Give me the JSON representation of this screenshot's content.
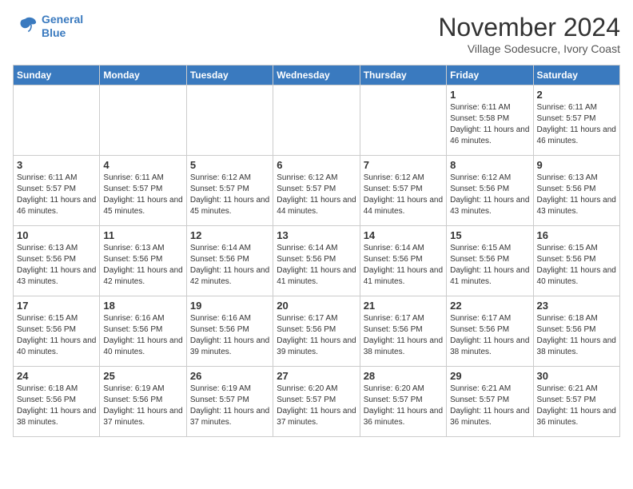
{
  "header": {
    "logo_line1": "General",
    "logo_line2": "Blue",
    "main_title": "November 2024",
    "subtitle": "Village Sodesucre, Ivory Coast"
  },
  "days_of_week": [
    "Sunday",
    "Monday",
    "Tuesday",
    "Wednesday",
    "Thursday",
    "Friday",
    "Saturday"
  ],
  "weeks": [
    [
      {
        "day": null
      },
      {
        "day": null
      },
      {
        "day": null
      },
      {
        "day": null
      },
      {
        "day": null
      },
      {
        "day": "1",
        "sunrise": "6:11 AM",
        "sunset": "5:58 PM",
        "daylight": "11 hours and 46 minutes."
      },
      {
        "day": "2",
        "sunrise": "6:11 AM",
        "sunset": "5:57 PM",
        "daylight": "11 hours and 46 minutes."
      }
    ],
    [
      {
        "day": "3",
        "sunrise": "6:11 AM",
        "sunset": "5:57 PM",
        "daylight": "11 hours and 46 minutes."
      },
      {
        "day": "4",
        "sunrise": "6:11 AM",
        "sunset": "5:57 PM",
        "daylight": "11 hours and 45 minutes."
      },
      {
        "day": "5",
        "sunrise": "6:12 AM",
        "sunset": "5:57 PM",
        "daylight": "11 hours and 45 minutes."
      },
      {
        "day": "6",
        "sunrise": "6:12 AM",
        "sunset": "5:57 PM",
        "daylight": "11 hours and 44 minutes."
      },
      {
        "day": "7",
        "sunrise": "6:12 AM",
        "sunset": "5:57 PM",
        "daylight": "11 hours and 44 minutes."
      },
      {
        "day": "8",
        "sunrise": "6:12 AM",
        "sunset": "5:56 PM",
        "daylight": "11 hours and 43 minutes."
      },
      {
        "day": "9",
        "sunrise": "6:13 AM",
        "sunset": "5:56 PM",
        "daylight": "11 hours and 43 minutes."
      }
    ],
    [
      {
        "day": "10",
        "sunrise": "6:13 AM",
        "sunset": "5:56 PM",
        "daylight": "11 hours and 43 minutes."
      },
      {
        "day": "11",
        "sunrise": "6:13 AM",
        "sunset": "5:56 PM",
        "daylight": "11 hours and 42 minutes."
      },
      {
        "day": "12",
        "sunrise": "6:14 AM",
        "sunset": "5:56 PM",
        "daylight": "11 hours and 42 minutes."
      },
      {
        "day": "13",
        "sunrise": "6:14 AM",
        "sunset": "5:56 PM",
        "daylight": "11 hours and 41 minutes."
      },
      {
        "day": "14",
        "sunrise": "6:14 AM",
        "sunset": "5:56 PM",
        "daylight": "11 hours and 41 minutes."
      },
      {
        "day": "15",
        "sunrise": "6:15 AM",
        "sunset": "5:56 PM",
        "daylight": "11 hours and 41 minutes."
      },
      {
        "day": "16",
        "sunrise": "6:15 AM",
        "sunset": "5:56 PM",
        "daylight": "11 hours and 40 minutes."
      }
    ],
    [
      {
        "day": "17",
        "sunrise": "6:15 AM",
        "sunset": "5:56 PM",
        "daylight": "11 hours and 40 minutes."
      },
      {
        "day": "18",
        "sunrise": "6:16 AM",
        "sunset": "5:56 PM",
        "daylight": "11 hours and 40 minutes."
      },
      {
        "day": "19",
        "sunrise": "6:16 AM",
        "sunset": "5:56 PM",
        "daylight": "11 hours and 39 minutes."
      },
      {
        "day": "20",
        "sunrise": "6:17 AM",
        "sunset": "5:56 PM",
        "daylight": "11 hours and 39 minutes."
      },
      {
        "day": "21",
        "sunrise": "6:17 AM",
        "sunset": "5:56 PM",
        "daylight": "11 hours and 38 minutes."
      },
      {
        "day": "22",
        "sunrise": "6:17 AM",
        "sunset": "5:56 PM",
        "daylight": "11 hours and 38 minutes."
      },
      {
        "day": "23",
        "sunrise": "6:18 AM",
        "sunset": "5:56 PM",
        "daylight": "11 hours and 38 minutes."
      }
    ],
    [
      {
        "day": "24",
        "sunrise": "6:18 AM",
        "sunset": "5:56 PM",
        "daylight": "11 hours and 38 minutes."
      },
      {
        "day": "25",
        "sunrise": "6:19 AM",
        "sunset": "5:56 PM",
        "daylight": "11 hours and 37 minutes."
      },
      {
        "day": "26",
        "sunrise": "6:19 AM",
        "sunset": "5:57 PM",
        "daylight": "11 hours and 37 minutes."
      },
      {
        "day": "27",
        "sunrise": "6:20 AM",
        "sunset": "5:57 PM",
        "daylight": "11 hours and 37 minutes."
      },
      {
        "day": "28",
        "sunrise": "6:20 AM",
        "sunset": "5:57 PM",
        "daylight": "11 hours and 36 minutes."
      },
      {
        "day": "29",
        "sunrise": "6:21 AM",
        "sunset": "5:57 PM",
        "daylight": "11 hours and 36 minutes."
      },
      {
        "day": "30",
        "sunrise": "6:21 AM",
        "sunset": "5:57 PM",
        "daylight": "11 hours and 36 minutes."
      }
    ]
  ]
}
